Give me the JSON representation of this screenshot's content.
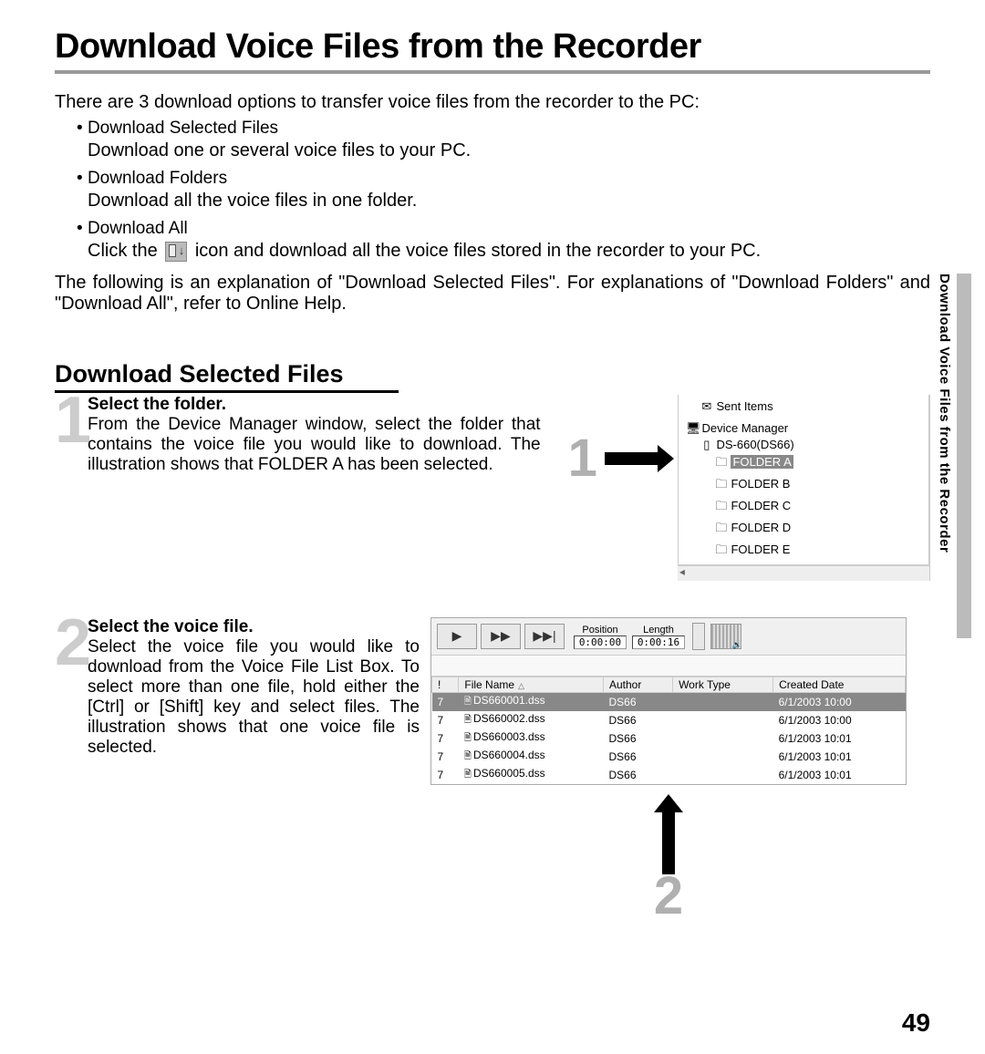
{
  "page": {
    "title": "Download Voice Files from the Recorder",
    "intro": "There are 3 download options to transfer voice files from the recorder to the PC:",
    "bullets": [
      {
        "title": "Download Selected Files",
        "desc": "Download one or several voice files to your PC."
      },
      {
        "title": "Download Folders",
        "desc": "Download all the voice files in one folder."
      },
      {
        "title": "Download All",
        "desc_pre": "Click the ",
        "desc_post": " icon and download all the voice files stored in the recorder to your PC."
      }
    ],
    "explain": "The following is an explanation of \"Download Selected Files\". For explanations of \"Download Folders\" and \"Download All\", refer to Online Help.",
    "section_title": "Download Selected Files",
    "side_label": "Download Voice Files from the Recorder",
    "page_number": "49"
  },
  "steps": {
    "s1": {
      "num": "1",
      "title": "Select the folder.",
      "text": "From the Device Manager window, select the folder that contains the voice file you would like to download. The illustration shows that FOLDER A has been selected."
    },
    "s2": {
      "num": "2",
      "title": "Select the voice file.",
      "text": "Select the voice file you would like to download from the Voice File List Box. To select more than one file, hold either the [Ctrl] or [Shift] key and select files. The illustration shows that one voice file is selected."
    }
  },
  "tree": {
    "sent_items": "Sent Items",
    "device_manager": "Device Manager",
    "device": "DS-660(DS66)",
    "folders": [
      "FOLDER A",
      "FOLDER B",
      "FOLDER C",
      "FOLDER D",
      "FOLDER E"
    ]
  },
  "callout": {
    "one": "1",
    "two": "2"
  },
  "player": {
    "pos_label": "Position",
    "pos_value": "0:00:00",
    "len_label": "Length",
    "len_value": "0:00:16"
  },
  "table": {
    "headers": {
      "pri": "!",
      "name": "File Name",
      "author": "Author",
      "worktype": "Work Type",
      "created": "Created Date"
    },
    "rows": [
      {
        "pri": "7",
        "name": "DS660001.dss",
        "author": "DS66",
        "worktype": "",
        "created": "6/1/2003 10:00",
        "selected": true
      },
      {
        "pri": "7",
        "name": "DS660002.dss",
        "author": "DS66",
        "worktype": "",
        "created": "6/1/2003 10:00",
        "selected": false
      },
      {
        "pri": "7",
        "name": "DS660003.dss",
        "author": "DS66",
        "worktype": "",
        "created": "6/1/2003 10:01",
        "selected": false
      },
      {
        "pri": "7",
        "name": "DS660004.dss",
        "author": "DS66",
        "worktype": "",
        "created": "6/1/2003 10:01",
        "selected": false
      },
      {
        "pri": "7",
        "name": "DS660005.dss",
        "author": "DS66",
        "worktype": "",
        "created": "6/1/2003 10:01",
        "selected": false
      }
    ]
  }
}
